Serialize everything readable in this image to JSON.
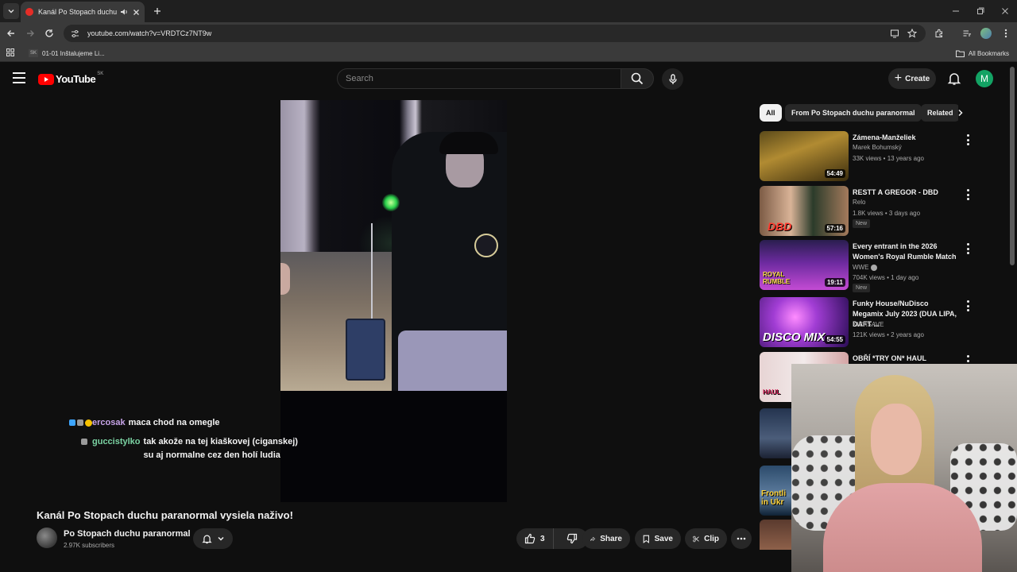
{
  "browser": {
    "tab_title": "Kanál Po Stopach duchu pa",
    "address": "youtube.com/watch?v=VRDTCz7NT9w",
    "bookmark_favicon": "SK",
    "bookmark_label": "01-01 Inštalujeme Li...",
    "all_bookmarks": "All Bookmarks"
  },
  "header": {
    "logo_text": "YouTube",
    "country_code": "SK",
    "search_placeholder": "Search",
    "create_label": "Create",
    "avatar_letter": "M"
  },
  "chat": [
    {
      "name": "ercosak",
      "name_color": "#c7a4e8",
      "message": "maca chod na omegle"
    },
    {
      "name": "guccistylko",
      "name_color": "#7bd3a3",
      "message": "tak akože na tej kiaškovej (ciganskej) su aj normalne cez den holí ludia"
    }
  ],
  "video": {
    "title": "Kanál Po Stopach duchu paranormal vysiela naživo!",
    "channel": "Po Stopach duchu paranormal",
    "subscribers": "2.97K subscribers",
    "likes": "3",
    "share_label": "Share",
    "save_label": "Save",
    "clip_label": "Clip"
  },
  "chips": [
    {
      "label": "All"
    },
    {
      "label": "From Po Stopach duchu paranormal"
    },
    {
      "label": "Related"
    }
  ],
  "recommendations": [
    {
      "title": "Zámena-Manželiek",
      "channel": "Marek Bohumský",
      "meta": "33K views • 13 years ago",
      "duration": "54:49",
      "new": ""
    },
    {
      "title": "RESTT A GREGOR - DBD",
      "channel": "Relo",
      "meta": "1.8K views • 3 days ago",
      "duration": "57:16",
      "new": "New",
      "thumb_text": "DBD"
    },
    {
      "title": "Every entrant in the 2026 Women's Royal Rumble Match",
      "channel": "WWE",
      "meta": "704K views • 1 day ago",
      "duration": "19:11",
      "new": "New",
      "thumb_text": "ROYAL RUMBLE"
    },
    {
      "title": "Funky House/NuDisco Megamix July 2023 (DUA LIPA, DAFT ...",
      "channel": "KICKSAVE",
      "meta": "121K views • 2 years ago",
      "duration": "54:55",
      "new": "",
      "thumb_text": "DISCO MIX"
    },
    {
      "title": "OBŘÍ *TRY ON* HAUL",
      "channel": "",
      "meta": "",
      "duration": "",
      "new": "",
      "thumb_text": "HAUL"
    },
    {
      "title": "",
      "channel": "",
      "meta": "",
      "duration": "",
      "new": ""
    },
    {
      "title": "",
      "channel": "",
      "meta": "",
      "duration": "",
      "new": "",
      "thumb_text": "Frontli in Ukr"
    },
    {
      "title": "",
      "channel": "",
      "meta": "",
      "duration": "",
      "new": ""
    }
  ],
  "colors": {
    "background": "#0f0f0f",
    "brand_red": "#ff0000",
    "avatar_green": "#13a364"
  }
}
